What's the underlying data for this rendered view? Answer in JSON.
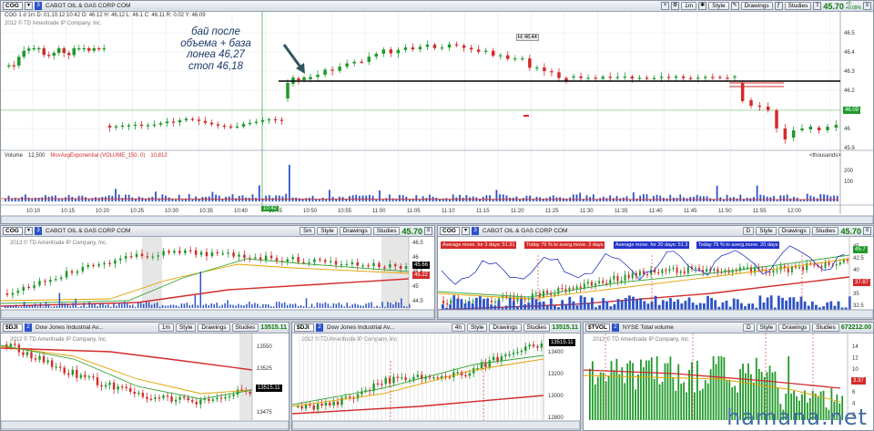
{
  "main": {
    "symbol": "COG",
    "interval": "1m",
    "company": "CABOT OIL & GAS CORP COM",
    "price": "45.70",
    "change_top": "+0",
    "change_bottom": "+0.09%",
    "buttons": {
      "style": "Style",
      "drawings": "Drawings",
      "studies": "Studies"
    },
    "ohlc_info": "COG 1 d 1m   D: 01.10.12 10:42   O: 46.12   H: 46.12   L: 46.1   C: 46.11   R: 0.02   Y: 46.09",
    "copyright": "2012 © TD Ameritrade IP Company, Inc.",
    "annotation_lines": [
      "бай после",
      "объема + база",
      "лонеа 46,27",
      "стоп 46,18"
    ],
    "hilo_label": "H: 46.44",
    "price_scale": [
      "46.5",
      "46.4",
      "46.3",
      "46.2",
      "46.1",
      "46",
      "45.9"
    ],
    "last_price_tag": "46.09",
    "volume_info": [
      "Volume",
      "12,500",
      "MovAvgExponential (VOLUME_150, 0)",
      "10,812"
    ],
    "volume_unit": "<thousands>",
    "volume_scale": [
      "200",
      "100"
    ],
    "time_labels": [
      "10:10",
      "10:15",
      "10:20",
      "10:25",
      "10:30",
      "10:35",
      "10:40",
      "10:45",
      "10:50",
      "10:55",
      "11:00",
      "11:05",
      "11:10",
      "11:15",
      "11:20",
      "11:25",
      "11:30",
      "11:35",
      "11:40",
      "11:45",
      "11:50",
      "11:55",
      "12:00"
    ],
    "time_highlight": "10:42"
  },
  "mid_left": {
    "symbol": "COG",
    "interval": "5m",
    "company": "CABOT OIL & GAS CORP COM",
    "price": "45.70",
    "copyright": "2012 © TD Ameritrade IP Company, Inc.",
    "scale": [
      "46.5",
      "46",
      "45.5",
      "45",
      "44.5"
    ],
    "tag1": "45.66",
    "tag2": "45.22"
  },
  "mid_right": {
    "symbol": "COG",
    "interval": "D",
    "company": "CABOT OIL & GAS CORP COM",
    "price": "45.70",
    "banners": [
      {
        "text": "Average move. for 3 days: 51.31",
        "color": "#d42b2b"
      },
      {
        "text": "Today 79 % to averg.move. 3 days",
        "color": "#d42b2b"
      },
      {
        "text": "Average move. for 20 days: 51.3",
        "color": "#2434c8"
      },
      {
        "text": "Today 79 % to averg.move. 20 days",
        "color": "#2434c8"
      }
    ],
    "scale": [
      "45",
      "42.5",
      "40",
      "37.5",
      "35",
      "32.5"
    ],
    "tag1": "45.7",
    "tag2": "37.87"
  },
  "bottom": [
    {
      "symbol": "$DJI",
      "interval": "1m",
      "company": "Dow Jones Industrial Av...",
      "price": "13515.11",
      "scale": [
        "13550",
        "13525",
        "13500",
        "13475"
      ],
      "tag": "13515.11"
    },
    {
      "symbol": "$DJI",
      "interval": "4h",
      "company": "Dow Jones Industrial Av...",
      "price": "13515.11",
      "scale": [
        "13400",
        "13200",
        "13000",
        "12800"
      ],
      "tag": "13515.11"
    },
    {
      "symbol": "$TVOL",
      "interval": "D",
      "company": "NYSE Total volume",
      "price": "672212.00",
      "scale": [
        "14",
        "12",
        "10",
        "8",
        "6",
        "4",
        "2"
      ],
      "tag": "3.37"
    }
  ],
  "bottom_copyright": "2012 © TD Ameritrade IP Company, Inc.",
  "watermark": "hamana.net",
  "colors": {
    "up": "#1f9a2a",
    "down": "#d42b2b",
    "volume": "#2d53c8",
    "accent": "#2d53c8"
  }
}
